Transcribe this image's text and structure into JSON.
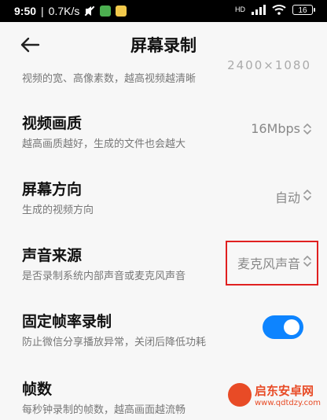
{
  "status_bar": {
    "time": "9:50",
    "speed": "0.7K/s",
    "network": "HD",
    "battery": "16"
  },
  "header": {
    "title": "屏幕录制"
  },
  "settings": [
    {
      "desc": "视频的宽、高像素数，越高视频越清晰",
      "value": "2400×1080"
    },
    {
      "title": "视频画质",
      "desc": "越高画质越好，生成的文件也会越大",
      "value": "16Mbps"
    },
    {
      "title": "屏幕方向",
      "desc": "生成的视频方向",
      "value": "自动"
    },
    {
      "title": "声音来源",
      "desc": "是否录制系统内部声音或麦克风声音",
      "value": "麦克风声音"
    },
    {
      "title": "固定帧率录制",
      "desc": "防止微信分享播放异常，关闭后降低功耗",
      "toggle_on": true
    },
    {
      "title": "帧数",
      "desc": "每秒钟录制的帧数，越高画面越流畅"
    }
  ],
  "colors": {
    "accent": "#0d84ff",
    "highlight": "#e02020"
  },
  "watermark": {
    "title": "启东安卓网",
    "url": "www.qdtdzy.com"
  }
}
